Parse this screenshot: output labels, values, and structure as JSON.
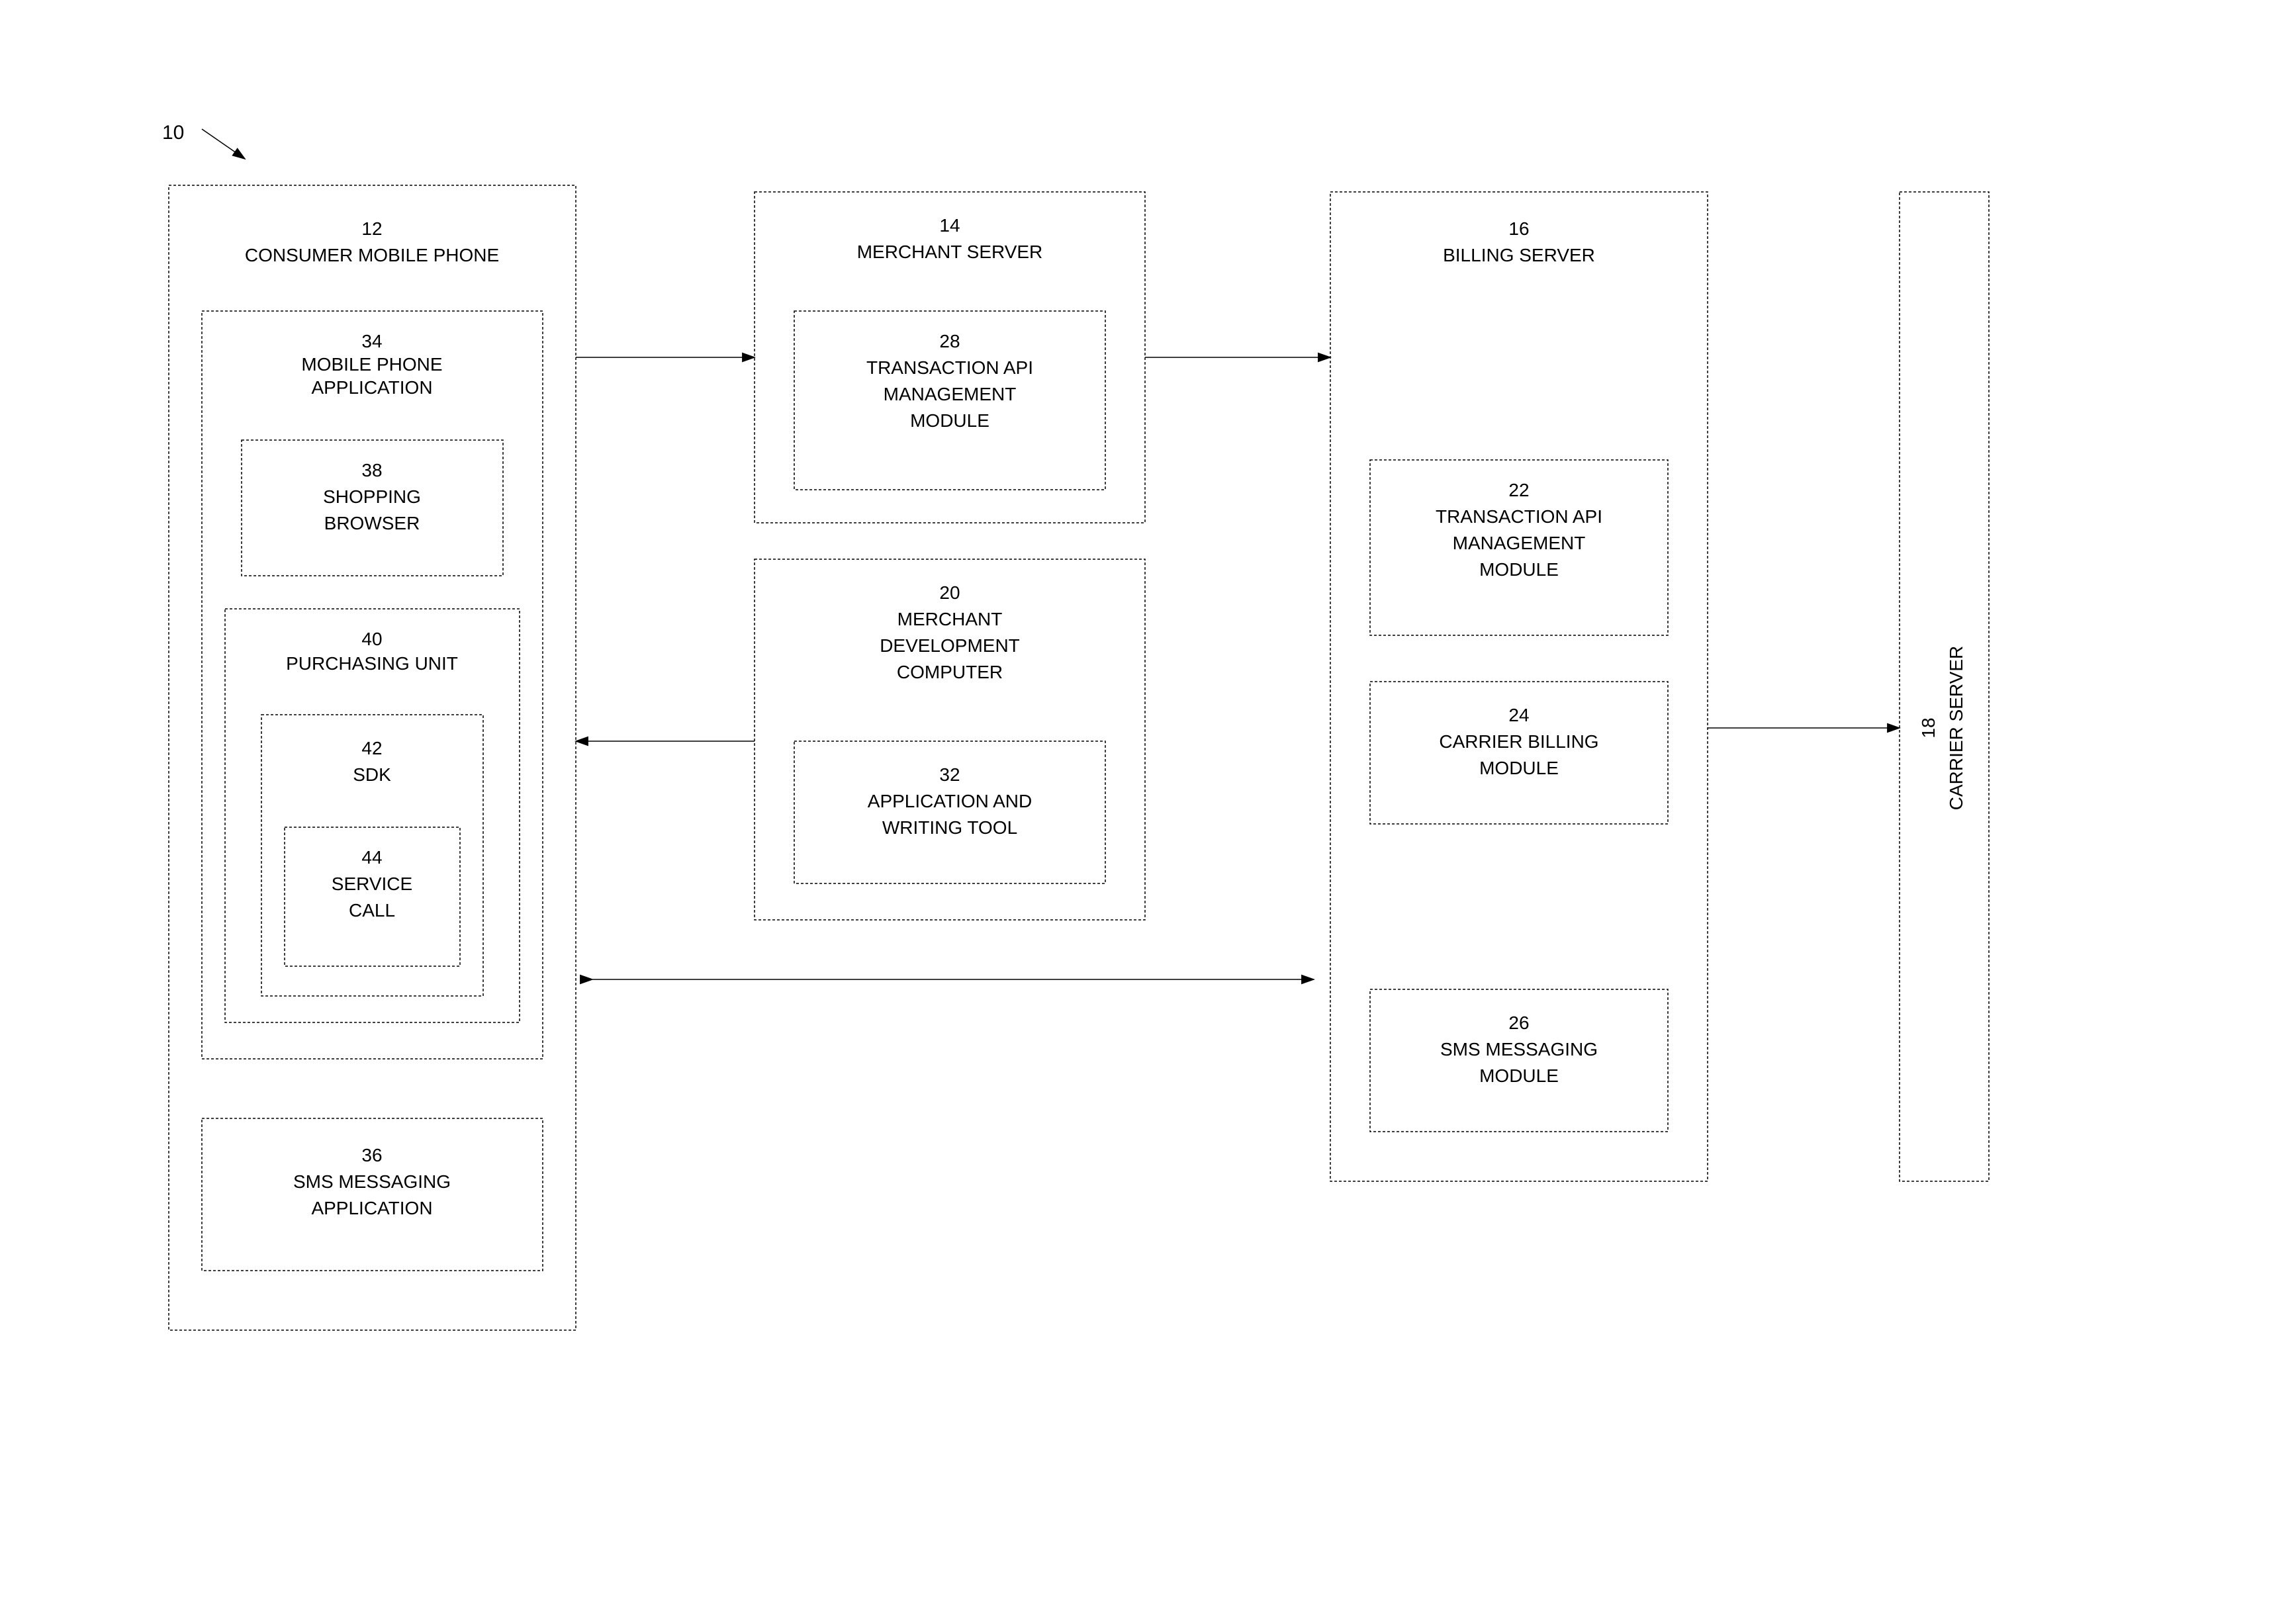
{
  "figure": {
    "ref": "10"
  },
  "blocks": {
    "consumer_phone": {
      "num": "12",
      "label": "CONSUMER MOBILE PHONE"
    },
    "mobile_app": {
      "num": "34",
      "label1": "MOBILE PHONE",
      "label2": "APPLICATION"
    },
    "shopping_browser": {
      "num": "38",
      "label1": "SHOPPING",
      "label2": "BROWSER"
    },
    "purchasing_unit": {
      "num": "40",
      "label": "PURCHASING UNIT"
    },
    "sdk": {
      "num": "42",
      "label": "SDK"
    },
    "service_call": {
      "num": "44",
      "label1": "SERVICE",
      "label2": "CALL"
    },
    "sms_app": {
      "num": "36",
      "label1": "SMS MESSAGING",
      "label2": "APPLICATION"
    },
    "merchant_server": {
      "num": "14",
      "label": "MERCHANT SERVER"
    },
    "trans_api_28": {
      "num": "28",
      "label1": "TRANSACTION API",
      "label2": "MANAGEMENT",
      "label3": "MODULE"
    },
    "merchant_dev": {
      "num": "20",
      "label1": "MERCHANT",
      "label2": "DEVELOPMENT",
      "label3": "COMPUTER"
    },
    "app_writing": {
      "num": "32",
      "label1": "APPLICATION AND",
      "label2": "WRITING TOOL"
    },
    "billing_server": {
      "num": "16",
      "label": "BILLING SERVER"
    },
    "trans_api_22": {
      "num": "22",
      "label1": "TRANSACTION API",
      "label2": "MANAGEMENT",
      "label3": "MODULE"
    },
    "carrier_billing": {
      "num": "24",
      "label1": "CARRIER BILLING",
      "label2": "MODULE"
    },
    "sms_module": {
      "num": "26",
      "label1": "SMS MESSAGING",
      "label2": "MODULE"
    },
    "carrier_server": {
      "num": "18",
      "label": "CARRIER SERVER"
    }
  }
}
